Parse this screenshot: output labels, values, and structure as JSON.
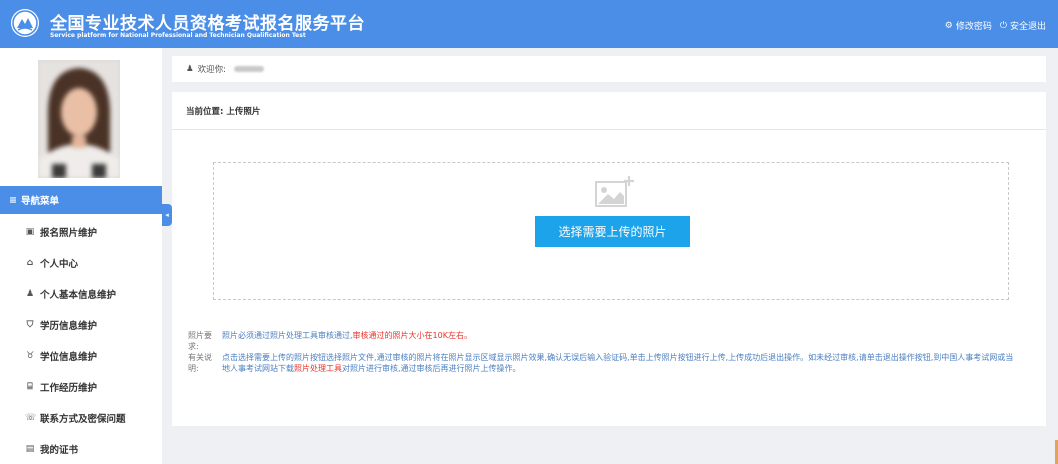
{
  "header": {
    "title_cn": "全国专业技术人员资格考试报名服务平台",
    "title_en": "Service platform for National Professional and Technician Qualification Test",
    "actions": [
      {
        "icon": "gear-icon",
        "glyph": "⚙",
        "label": "修改密码"
      },
      {
        "icon": "power-icon",
        "glyph": "⏻",
        "label": "安全退出"
      }
    ]
  },
  "sidebar": {
    "nav_header": {
      "icon": "menu-icon",
      "glyph": "≡",
      "label": "导航菜单"
    },
    "items": [
      {
        "icon": "image-icon",
        "glyph": "▣",
        "label": "报名照片维护"
      },
      {
        "icon": "home-icon",
        "glyph": "⌂",
        "label": "个人中心"
      },
      {
        "icon": "user-icon",
        "glyph": "♟",
        "label": "个人基本信息维护"
      },
      {
        "icon": "graduation-cap-icon",
        "glyph": "⛉",
        "label": "学历信息维护"
      },
      {
        "icon": "degree-icon",
        "glyph": "♉",
        "label": "学位信息维护"
      },
      {
        "icon": "building-icon",
        "glyph": "⌸",
        "label": "工作经历维护"
      },
      {
        "icon": "phone-icon",
        "glyph": "☏",
        "label": "联系方式及密保问题"
      },
      {
        "icon": "certificate-icon",
        "glyph": "▤",
        "label": "我的证书"
      }
    ],
    "collapse_glyph": "◂"
  },
  "welcome": {
    "icon": "user-icon",
    "glyph": "♟",
    "label": "欢迎你:"
  },
  "breadcrumb": "当前位置: 上传照片",
  "upload": {
    "button_label": "选择需要上传的照片",
    "icon": "add-image-icon"
  },
  "notes": {
    "req_label": "照片要求:",
    "req_text": "照片必须通过照片处理工具审核通过,",
    "req_red": "审核通过的照片大小在10K左右。",
    "desc_label": "有关说明:",
    "desc_text_1": "点击选择需要上传的照片按钮选择照片文件,通过审核的照片将在照片显示区域显示照片效果,确认无误后输入验证码,单击上传照片按钮进行上传,上传成功后退出操作。如未经过审核,请单击退出操作按钮,到中国人事考试网或当地人事考试网站下载",
    "desc_red": "照片处理工具",
    "desc_text_2": "对照片进行审核,通过审核后再进行照片上传操作。"
  },
  "colors": {
    "header": "#4a8ee8",
    "upload_button": "#1ca3ea",
    "note_text": "#4a7fc1",
    "note_red": "#e8322c"
  }
}
